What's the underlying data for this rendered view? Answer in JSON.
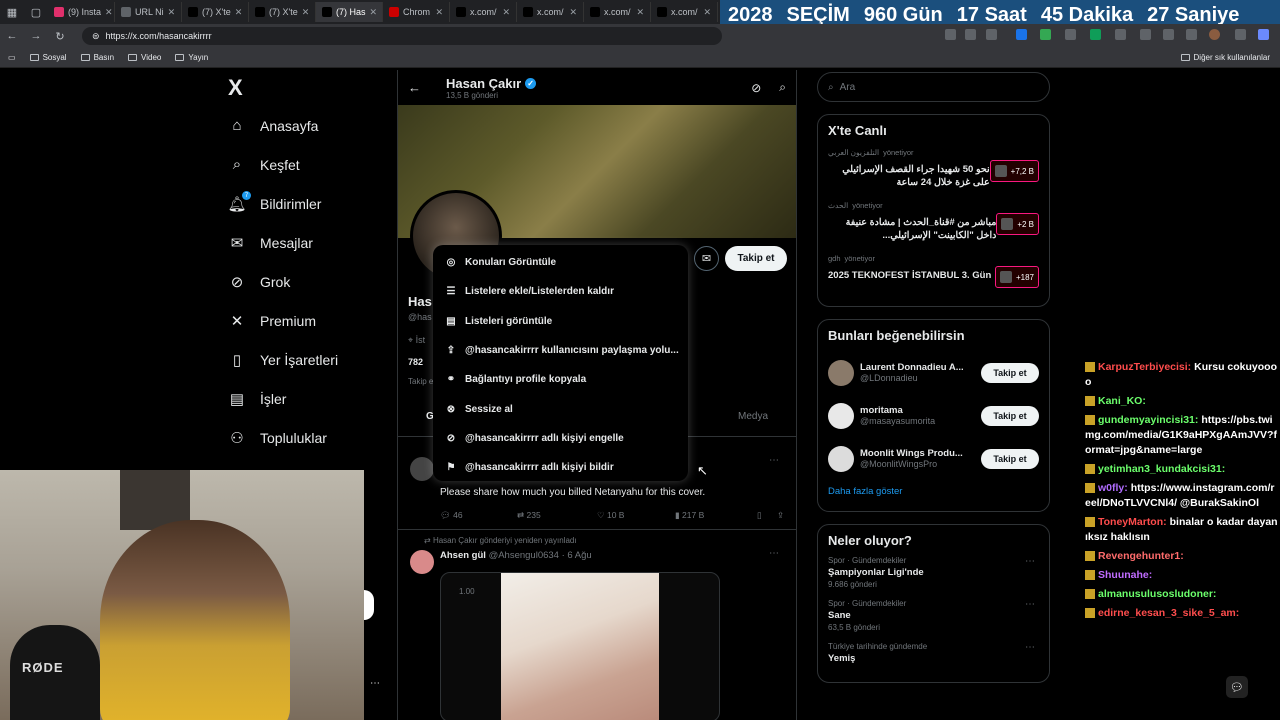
{
  "browser": {
    "tabs": [
      {
        "label": "(9) Insta",
        "color": "#e1306c"
      },
      {
        "label": "URL Ni",
        "color": "#5f6368"
      },
      {
        "label": "(7) X'te",
        "color": "#000000"
      },
      {
        "label": "(7) X'te",
        "color": "#000000"
      },
      {
        "label": "(7) Has",
        "color": "#000000"
      },
      {
        "label": "Chrom",
        "color": "#cc0000"
      },
      {
        "label": "x.com/",
        "color": "#000000"
      },
      {
        "label": "x.com/",
        "color": "#000000"
      },
      {
        "label": "x.com/",
        "color": "#000000"
      },
      {
        "label": "x.com/",
        "color": "#000000"
      }
    ],
    "url": "https://x.com/hasancakirrrr",
    "bookmarks": [
      "Sosyal",
      "Basın",
      "Video",
      "Yayın"
    ],
    "other_bookmarks": "Diğer sık kullanılanlar"
  },
  "countdown": {
    "year": "2028",
    "label": "SEÇİM",
    "days": "960 Gün",
    "hours": "17 Saat",
    "minutes": "45 Dakika",
    "seconds": "27 Saniye",
    "bg_color": "#1b4f7d"
  },
  "nav": {
    "logo": "X",
    "items": [
      {
        "label": "Anasayfa",
        "icon": "home-icon"
      },
      {
        "label": "Keşfet",
        "icon": "search-icon"
      },
      {
        "label": "Bildirimler",
        "icon": "bell-icon",
        "badge": "7"
      },
      {
        "label": "Mesajlar",
        "icon": "mail-icon"
      },
      {
        "label": "Grok",
        "icon": "grok-icon"
      },
      {
        "label": "Premium",
        "icon": "x-icon"
      },
      {
        "label": "Yer İşaretleri",
        "icon": "bookmark-icon"
      },
      {
        "label": "İşler",
        "icon": "briefcase-icon"
      },
      {
        "label": "Topluluklar",
        "icon": "people-icon"
      }
    ]
  },
  "profile": {
    "name": "Hasan Çakır",
    "posts_count": "13,5 B gönderi",
    "follow_label": "Takip et",
    "name_partial": "Has",
    "handle_partial": "@has",
    "location_partial": "İst",
    "following_partial": "782",
    "followed_by_partial": "Takip e",
    "tab_partial": "G",
    "tab_media": "Medya"
  },
  "menu": {
    "items": [
      {
        "label": "Konuları Görüntüle",
        "icon": "topics-icon"
      },
      {
        "label": "Listelere ekle/Listelerden kaldır",
        "icon": "list-add-icon"
      },
      {
        "label": "Listeleri görüntüle",
        "icon": "list-icon"
      },
      {
        "label": "@hasancakirrrr kullanıcısını paylaşma yolu...",
        "icon": "share-icon"
      },
      {
        "label": "Bağlantıyı profile kopyala",
        "icon": "link-icon"
      },
      {
        "label": "Sessize al",
        "icon": "mute-icon"
      },
      {
        "label": "@hasancakirrrr adlı kişiyi engelle",
        "icon": "block-icon"
      },
      {
        "label": "@hasancakirrrr adlı kişiyi bildir",
        "icon": "flag-icon"
      }
    ]
  },
  "tweet1": {
    "text": "Please share how much you billed Netanyahu for this cover.",
    "replies": "46",
    "retweets": "235",
    "likes": "10 B",
    "views": "217 B"
  },
  "tweet2": {
    "retweet_label": "Hasan Çakır gönderiyi yeniden yayınladı",
    "author": "Ahsen gül",
    "handle_date": "@Ahsengul0634 · 6 Ağu",
    "video_time": "1.00"
  },
  "right": {
    "search_placeholder": "Ara",
    "live_title": "X'te Canlı",
    "live": [
      {
        "source": "التلفزيون العربي",
        "status": "yönetiyor",
        "text": "نحو 50 شهيدا جراء القصف الإسرائيلي على غزة خلال 24 ساعة",
        "count": "+7,2 B"
      },
      {
        "source": "الحدث",
        "status": "yönetiyor",
        "text": "مباشر من #قناة_الحدث | مشادة عنيفة داخل \"الكابينت\" الإسرائيلي...",
        "count": "+2 B"
      },
      {
        "source": "gdh",
        "status": "yönetiyor",
        "text": "2025 TEKNOFEST İSTANBUL 3. Gün",
        "count": "+187"
      }
    ],
    "suggest_title": "Bunları beğenebilirsin",
    "suggestions": [
      {
        "name": "Laurent Donnadieu A...",
        "handle": "@LDonnadieu",
        "button": "Takip et"
      },
      {
        "name": "moritama",
        "handle": "@masayasumorita",
        "button": "Takip et"
      },
      {
        "name": "Moonlit Wings Produ...",
        "handle": "@MoonlitWingsPro",
        "button": "Takip et"
      }
    ],
    "show_more": "Daha fazla göster",
    "trends_title": "Neler oluyor?",
    "trends": [
      {
        "category": "Spor · Gündemdekiler",
        "title": "Şampiyonlar Ligi'nde",
        "count": "9.686 gönderi"
      },
      {
        "category": "Spor · Gündemdekiler",
        "title": "Sane",
        "count": "63,5 B gönderi"
      },
      {
        "category": "Türkiye tarihinde gündemde",
        "title": "Yemiş",
        "count": ""
      }
    ]
  },
  "chat": [
    {
      "user": "KarpuzTerbiyecisi:",
      "text": "Kursu cokuyoooo",
      "color": "#ff4d4d"
    },
    {
      "user": "Kani_KO:",
      "text": "",
      "color": "#6cff6c"
    },
    {
      "user": "gundemyayincisi31:",
      "text": "https://pbs.twimg.com/media/G1K9aHPXgAAmJVV?format=jpg&name=large",
      "color": "#6cff6c"
    },
    {
      "user": "yetimhan3_kundakcisi31:",
      "text": "",
      "color": "#6cff6c"
    },
    {
      "user": "w0fly:",
      "text": "https://www.instagram.com/reel/DNoTLVVCNl4/ @BurakSakinOl",
      "color": "#b06cff"
    },
    {
      "user": "ToneyMarton:",
      "text": "binalar o kadar dayanıksız haklısın",
      "color": "#ff4d4d"
    },
    {
      "user": "Revengehunter1:",
      "text": "",
      "color": "#ff6c6c"
    },
    {
      "user": "Shuunahe:",
      "text": "",
      "color": "#c06cff"
    },
    {
      "user": "almanusulusosludoner:",
      "text": "",
      "color": "#6cff6c"
    },
    {
      "user": "edirne_kesan_3_sike_5_am:",
      "text": "",
      "color": "#ff4d4d"
    }
  ],
  "webcam": {
    "mic_brand": "RØDE"
  }
}
